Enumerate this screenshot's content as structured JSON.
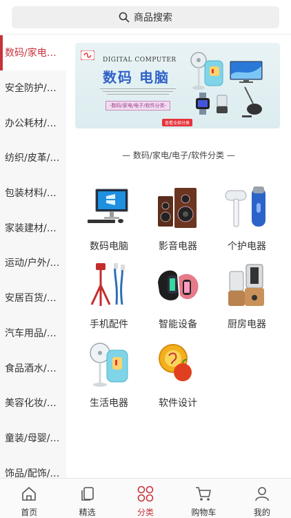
{
  "search": {
    "label": "商品搜索"
  },
  "sidebar": {
    "items": [
      {
        "label": "数码/家电…"
      },
      {
        "label": "安全防护/…"
      },
      {
        "label": "办公耗材/…"
      },
      {
        "label": "纺织/皮革/…"
      },
      {
        "label": "包装材料/…"
      },
      {
        "label": "家装建材/…"
      },
      {
        "label": "运动/户外/…"
      },
      {
        "label": "安居百货/…"
      },
      {
        "label": "汽车用品/…"
      },
      {
        "label": "食品酒水/…"
      },
      {
        "label": "美容化妆/…"
      },
      {
        "label": "童装/母婴/…"
      },
      {
        "label": "饰品/配饰/…"
      }
    ],
    "active_index": 0
  },
  "banner": {
    "subtitle_en": "DIGITAL COMPUTER",
    "title": "数码 电脑",
    "tag": "-数码/家电/电子/软件分类-",
    "link": "查看全部分类"
  },
  "section": {
    "title": "— 数码/家电/电子/软件分类 —"
  },
  "categories": [
    {
      "label": "数码电脑",
      "icon": "desktop-computer-icon"
    },
    {
      "label": "影音电器",
      "icon": "speaker-icon"
    },
    {
      "label": "个护电器",
      "icon": "hair-dryer-shaver-icon"
    },
    {
      "label": "手机配件",
      "icon": "phone-tripod-cable-icon"
    },
    {
      "label": "智能设备",
      "icon": "smart-band-icon"
    },
    {
      "label": "厨房电器",
      "icon": "blender-icon"
    },
    {
      "label": "生活电器",
      "icon": "fan-heater-icon"
    },
    {
      "label": "软件设计",
      "icon": "software-design-icon"
    }
  ],
  "tabbar": {
    "items": [
      {
        "label": "首页",
        "icon": "home-icon"
      },
      {
        "label": "精选",
        "icon": "pages-icon"
      },
      {
        "label": "分类",
        "icon": "category-icon"
      },
      {
        "label": "购物车",
        "icon": "cart-icon"
      },
      {
        "label": "我的",
        "icon": "user-icon"
      }
    ],
    "active_index": 2
  },
  "colors": {
    "accent": "#c8323a",
    "banner_blue": "#2f62c7"
  }
}
